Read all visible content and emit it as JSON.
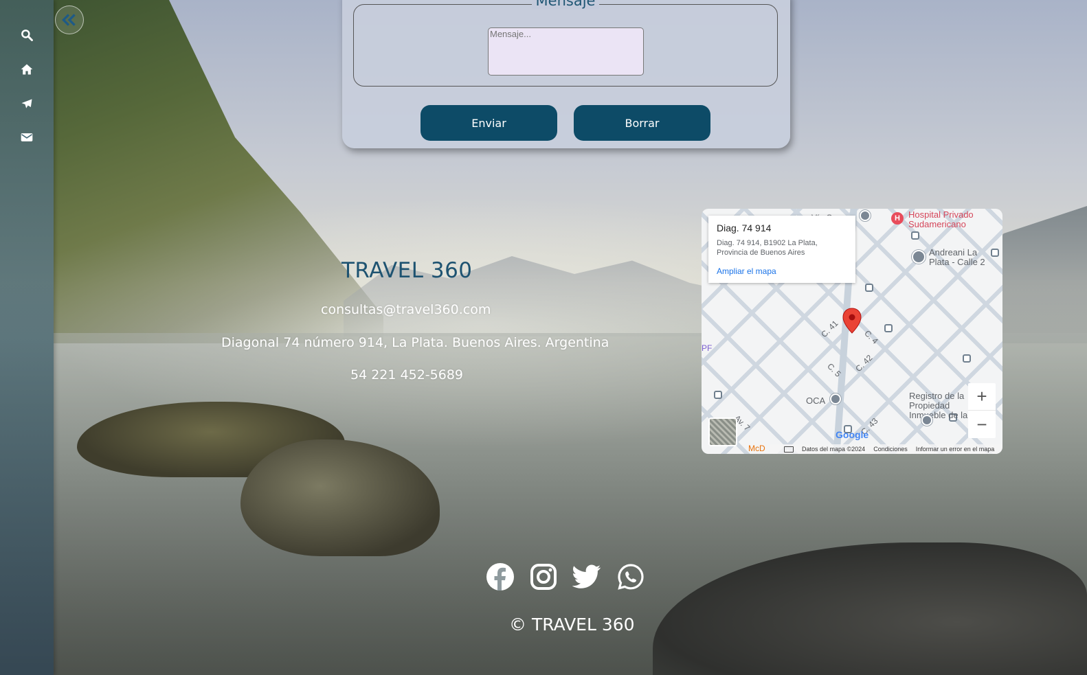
{
  "sidebar": {
    "items": [
      {
        "icon": "search-icon"
      },
      {
        "icon": "home-icon"
      },
      {
        "icon": "airplane-icon"
      },
      {
        "icon": "mail-icon"
      }
    ],
    "collapse_icon": "double-chevron-left-icon"
  },
  "form": {
    "legend": "Mensaje",
    "message_placeholder": "Mensaje...",
    "send_label": "Enviar",
    "clear_label": "Borrar"
  },
  "contact": {
    "brand": "TRAVEL 360",
    "email": "consultas@travel360.com",
    "address": "Diagonal 74 número 914, La Plata. Buenos Aires. Argentina",
    "phone": "54 221 452-5689"
  },
  "map": {
    "place_title": "Diag. 74 914",
    "place_address": "Diag. 74 914, B1902 La Plata, Provincia de Buenos Aires",
    "enlarge_link": "Ampliar el mapa",
    "pois": {
      "hospital": "Hospital Privado Sudamericano",
      "andreani": "Andreani La Plata - Calle 2",
      "oca": "OCA",
      "registro": "Registro de la Propiedad Inmueble de la",
      "via_corsa": "Vía Corsa",
      "mcd": "McD"
    },
    "streets": [
      "C. 41",
      "C. 4",
      "C. 42",
      "C. 5",
      "Av. 7",
      "C. 43",
      "PF"
    ],
    "footer": {
      "brand": "Google",
      "data": "Datos del mapa ©2024",
      "terms": "Condiciones",
      "report": "Informar un error en el mapa"
    },
    "zoom_in": "+",
    "zoom_out": "−",
    "pin_color": "#ea4335"
  },
  "social": [
    {
      "name": "facebook-icon"
    },
    {
      "name": "instagram-icon"
    },
    {
      "name": "twitter-icon"
    },
    {
      "name": "whatsapp-icon"
    }
  ],
  "footer": {
    "copyright": "© TRAVEL 360"
  },
  "colors": {
    "accent": "#0d4b67",
    "brand_text": "#1e5371"
  }
}
